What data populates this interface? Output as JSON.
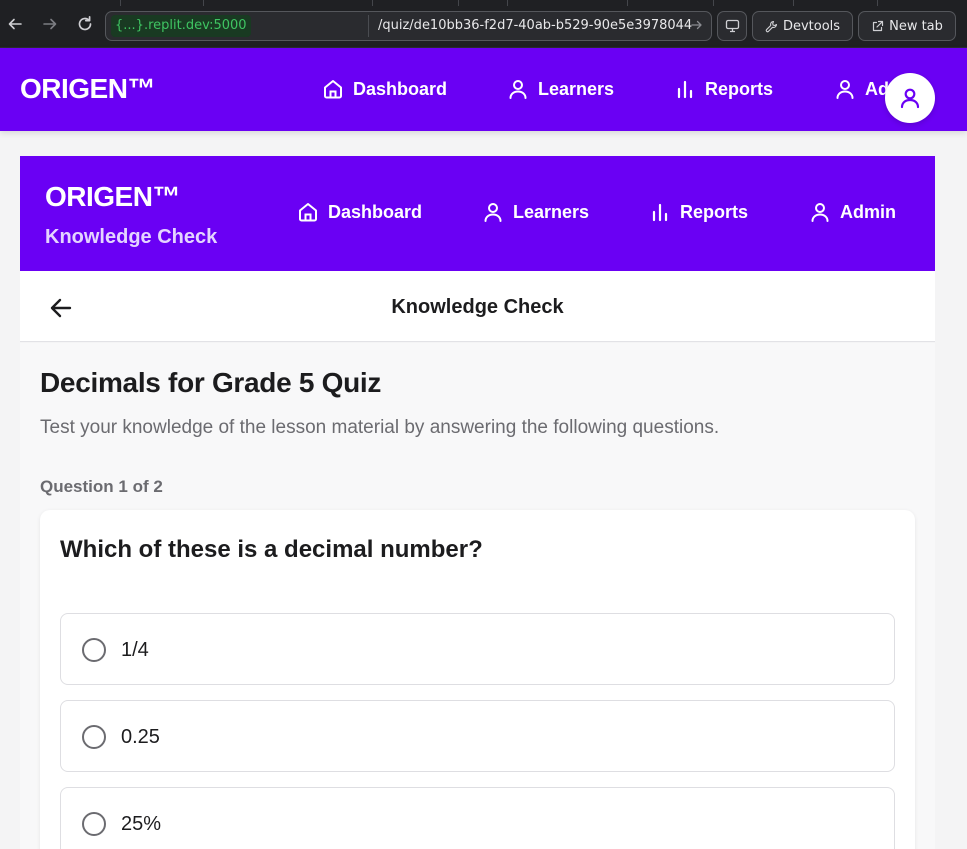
{
  "browser": {
    "url_host": "{...}.replit.dev:5000",
    "url_path": "/quiz/de10bb36-f2d7-40ab-b529-90e5e3978044",
    "devtools_label": "Devtools",
    "newtab_label": "New tab"
  },
  "app_header": {
    "brand": "ORIGEN™",
    "nav": [
      {
        "label": "Dashboard",
        "icon": "home-icon"
      },
      {
        "label": "Learners",
        "icon": "user-icon"
      },
      {
        "label": "Reports",
        "icon": "bar-chart-icon"
      },
      {
        "label": "Ad",
        "icon": "user-icon"
      }
    ],
    "avatar_icon": "user-icon"
  },
  "inner_header": {
    "brand": "ORIGEN™",
    "subtitle": "Knowledge Check",
    "nav": [
      {
        "label": "Dashboard",
        "icon": "home-icon"
      },
      {
        "label": "Learners",
        "icon": "user-icon"
      },
      {
        "label": "Reports",
        "icon": "bar-chart-icon"
      },
      {
        "label": "Admin",
        "icon": "user-icon"
      }
    ]
  },
  "subbar": {
    "title": "Knowledge Check",
    "back_icon": "arrow-left-icon"
  },
  "quiz": {
    "title": "Decimals for Grade 5 Quiz",
    "description": "Test your knowledge of the lesson material by answering the following questions.",
    "question_counter": "Question 1 of 2",
    "question": "Which of these is a decimal number?",
    "options": [
      "1/4",
      "0.25",
      "25%"
    ],
    "selected": null
  },
  "colors": {
    "brand_purple": "#6a00f4",
    "subtitle_lavender": "#e4d4ff",
    "text_dark": "#1c1c1e",
    "text_muted": "#6b6b70",
    "browser_bg": "#1f2023",
    "url_host_green": "#3fc462"
  }
}
